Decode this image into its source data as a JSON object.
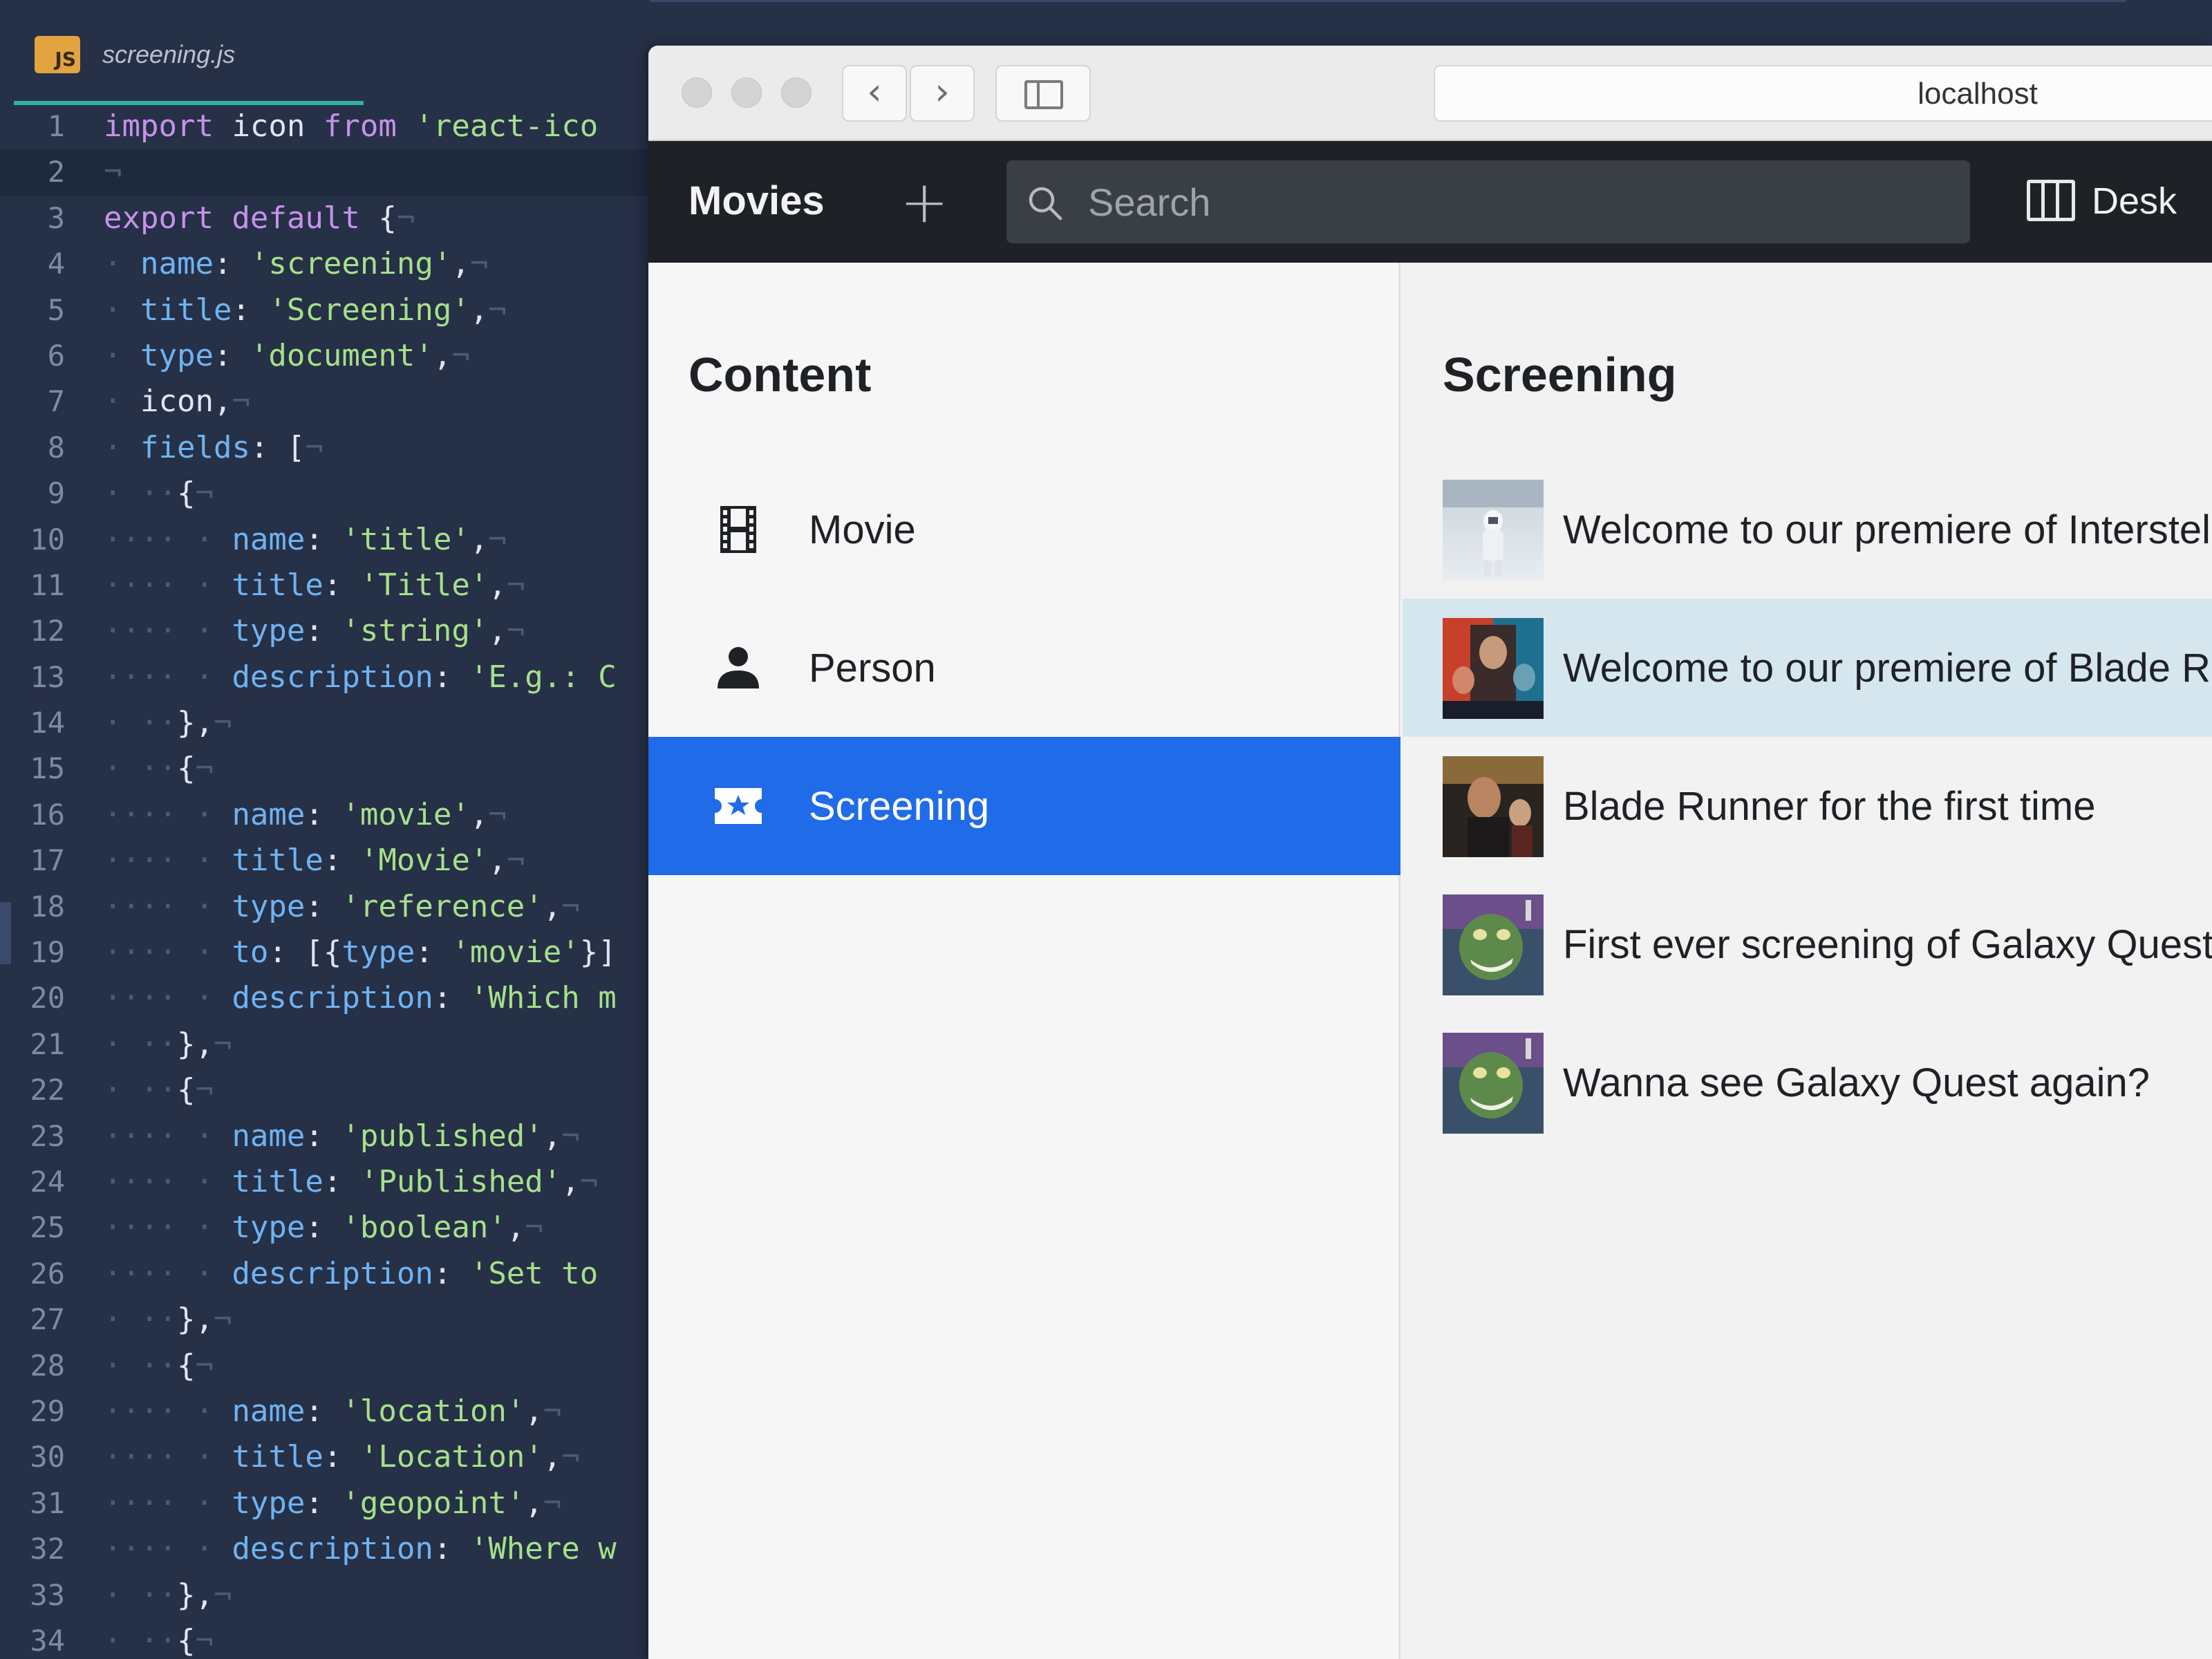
{
  "editor": {
    "file_badge": "JS",
    "file_name": "screening.js",
    "lines": [
      {
        "n": "1",
        "t": [
          [
            "kw",
            "import"
          ],
          [
            "id",
            " icon "
          ],
          [
            "kw",
            "from"
          ],
          [
            "str",
            " 'react-ico"
          ]
        ]
      },
      {
        "n": "2",
        "t": [
          [
            "inv",
            "¬"
          ]
        ]
      },
      {
        "n": "3",
        "t": [
          [
            "kw",
            "export default"
          ],
          [
            "pun",
            " {"
          ],
          [
            "inv",
            "¬"
          ]
        ]
      },
      {
        "n": "4",
        "t": [
          [
            "ws",
            "·"
          ],
          [
            "prop",
            " name"
          ],
          [
            "pun",
            ": "
          ],
          [
            "str",
            "'screening'"
          ],
          [
            "pun",
            ","
          ],
          [
            "inv",
            "¬"
          ]
        ]
      },
      {
        "n": "5",
        "t": [
          [
            "ws",
            "·"
          ],
          [
            "prop",
            " title"
          ],
          [
            "pun",
            ": "
          ],
          [
            "str",
            "'Screening'"
          ],
          [
            "pun",
            ","
          ],
          [
            "inv",
            "¬"
          ]
        ]
      },
      {
        "n": "6",
        "t": [
          [
            "ws",
            "·"
          ],
          [
            "prop",
            " type"
          ],
          [
            "pun",
            ": "
          ],
          [
            "str",
            "'document'"
          ],
          [
            "pun",
            ","
          ],
          [
            "inv",
            "¬"
          ]
        ]
      },
      {
        "n": "7",
        "t": [
          [
            "ws",
            "·"
          ],
          [
            "id",
            " icon,"
          ],
          [
            "inv",
            "¬"
          ]
        ]
      },
      {
        "n": "8",
        "t": [
          [
            "ws",
            "·"
          ],
          [
            "prop",
            " fields"
          ],
          [
            "pun",
            ": ["
          ],
          [
            "inv",
            "¬"
          ]
        ]
      },
      {
        "n": "9",
        "t": [
          [
            "ws",
            "·"
          ],
          [
            "ws",
            " ··"
          ],
          [
            "pun",
            "{"
          ],
          [
            "inv",
            "¬"
          ]
        ]
      },
      {
        "n": "10",
        "t": [
          [
            "ws",
            "···· ·"
          ],
          [
            "prop",
            " name"
          ],
          [
            "pun",
            ": "
          ],
          [
            "str",
            "'title'"
          ],
          [
            "pun",
            ","
          ],
          [
            "inv",
            "¬"
          ]
        ]
      },
      {
        "n": "11",
        "t": [
          [
            "ws",
            "···· ·"
          ],
          [
            "prop",
            " title"
          ],
          [
            "pun",
            ": "
          ],
          [
            "str",
            "'Title'"
          ],
          [
            "pun",
            ","
          ],
          [
            "inv",
            "¬"
          ]
        ]
      },
      {
        "n": "12",
        "t": [
          [
            "ws",
            "···· ·"
          ],
          [
            "prop",
            " type"
          ],
          [
            "pun",
            ": "
          ],
          [
            "str",
            "'string'"
          ],
          [
            "pun",
            ","
          ],
          [
            "inv",
            "¬"
          ]
        ]
      },
      {
        "n": "13",
        "t": [
          [
            "ws",
            "···· ·"
          ],
          [
            "prop",
            " description"
          ],
          [
            "pun",
            ": "
          ],
          [
            "str",
            "'E.g.: C"
          ]
        ]
      },
      {
        "n": "14",
        "t": [
          [
            "ws",
            "·"
          ],
          [
            "ws",
            " ··"
          ],
          [
            "pun",
            "},"
          ],
          [
            "inv",
            "¬"
          ]
        ]
      },
      {
        "n": "15",
        "t": [
          [
            "ws",
            "·"
          ],
          [
            "ws",
            " ··"
          ],
          [
            "pun",
            "{"
          ],
          [
            "inv",
            "¬"
          ]
        ]
      },
      {
        "n": "16",
        "t": [
          [
            "ws",
            "···· ·"
          ],
          [
            "prop",
            " name"
          ],
          [
            "pun",
            ": "
          ],
          [
            "str",
            "'movie'"
          ],
          [
            "pun",
            ","
          ],
          [
            "inv",
            "¬"
          ]
        ]
      },
      {
        "n": "17",
        "t": [
          [
            "ws",
            "···· ·"
          ],
          [
            "prop",
            " title"
          ],
          [
            "pun",
            ": "
          ],
          [
            "str",
            "'Movie'"
          ],
          [
            "pun",
            ","
          ],
          [
            "inv",
            "¬"
          ]
        ]
      },
      {
        "n": "18",
        "t": [
          [
            "ws",
            "···· ·"
          ],
          [
            "prop",
            " type"
          ],
          [
            "pun",
            ": "
          ],
          [
            "str",
            "'reference'"
          ],
          [
            "pun",
            ","
          ],
          [
            "inv",
            "¬"
          ]
        ]
      },
      {
        "n": "19",
        "t": [
          [
            "ws",
            "···· ·"
          ],
          [
            "prop",
            " to"
          ],
          [
            "pun",
            ": [{"
          ],
          [
            "prop",
            "type"
          ],
          [
            "pun",
            ": "
          ],
          [
            "str",
            "'movie'"
          ],
          [
            "pun",
            "}]"
          ]
        ]
      },
      {
        "n": "20",
        "t": [
          [
            "ws",
            "···· ·"
          ],
          [
            "prop",
            " description"
          ],
          [
            "pun",
            ": "
          ],
          [
            "str",
            "'Which m"
          ]
        ]
      },
      {
        "n": "21",
        "t": [
          [
            "ws",
            "·"
          ],
          [
            "ws",
            " ··"
          ],
          [
            "pun",
            "},"
          ],
          [
            "inv",
            "¬"
          ]
        ]
      },
      {
        "n": "22",
        "t": [
          [
            "ws",
            "·"
          ],
          [
            "ws",
            " ··"
          ],
          [
            "pun",
            "{"
          ],
          [
            "inv",
            "¬"
          ]
        ]
      },
      {
        "n": "23",
        "t": [
          [
            "ws",
            "···· ·"
          ],
          [
            "prop",
            " name"
          ],
          [
            "pun",
            ": "
          ],
          [
            "str",
            "'published'"
          ],
          [
            "pun",
            ","
          ],
          [
            "inv",
            "¬"
          ]
        ]
      },
      {
        "n": "24",
        "t": [
          [
            "ws",
            "···· ·"
          ],
          [
            "prop",
            " title"
          ],
          [
            "pun",
            ": "
          ],
          [
            "str",
            "'Published'"
          ],
          [
            "pun",
            ","
          ],
          [
            "inv",
            "¬"
          ]
        ]
      },
      {
        "n": "25",
        "t": [
          [
            "ws",
            "···· ·"
          ],
          [
            "prop",
            " type"
          ],
          [
            "pun",
            ": "
          ],
          [
            "str",
            "'boolean'"
          ],
          [
            "pun",
            ","
          ],
          [
            "inv",
            "¬"
          ]
        ]
      },
      {
        "n": "26",
        "t": [
          [
            "ws",
            "···· ·"
          ],
          [
            "prop",
            " description"
          ],
          [
            "pun",
            ": "
          ],
          [
            "str",
            "'Set to"
          ]
        ]
      },
      {
        "n": "27",
        "t": [
          [
            "ws",
            "·"
          ],
          [
            "ws",
            " ··"
          ],
          [
            "pun",
            "},"
          ],
          [
            "inv",
            "¬"
          ]
        ]
      },
      {
        "n": "28",
        "t": [
          [
            "ws",
            "·"
          ],
          [
            "ws",
            " ··"
          ],
          [
            "pun",
            "{"
          ],
          [
            "inv",
            "¬"
          ]
        ]
      },
      {
        "n": "29",
        "t": [
          [
            "ws",
            "···· ·"
          ],
          [
            "prop",
            " name"
          ],
          [
            "pun",
            ": "
          ],
          [
            "str",
            "'location'"
          ],
          [
            "pun",
            ","
          ],
          [
            "inv",
            "¬"
          ]
        ]
      },
      {
        "n": "30",
        "t": [
          [
            "ws",
            "···· ·"
          ],
          [
            "prop",
            " title"
          ],
          [
            "pun",
            ": "
          ],
          [
            "str",
            "'Location'"
          ],
          [
            "pun",
            ","
          ],
          [
            "inv",
            "¬"
          ]
        ]
      },
      {
        "n": "31",
        "t": [
          [
            "ws",
            "···· ·"
          ],
          [
            "prop",
            " type"
          ],
          [
            "pun",
            ": "
          ],
          [
            "str",
            "'geopoint'"
          ],
          [
            "pun",
            ","
          ],
          [
            "inv",
            "¬"
          ]
        ]
      },
      {
        "n": "32",
        "t": [
          [
            "ws",
            "···· ·"
          ],
          [
            "prop",
            " description"
          ],
          [
            "pun",
            ": "
          ],
          [
            "str",
            "'Where w"
          ]
        ]
      },
      {
        "n": "33",
        "t": [
          [
            "ws",
            "·"
          ],
          [
            "ws",
            " ··"
          ],
          [
            "pun",
            "},"
          ],
          [
            "inv",
            "¬"
          ]
        ]
      },
      {
        "n": "34",
        "t": [
          [
            "ws",
            "·"
          ],
          [
            "ws",
            " ··"
          ],
          [
            "pun",
            "{"
          ],
          [
            "inv",
            "¬"
          ]
        ]
      }
    ]
  },
  "browser": {
    "back_icon": "chevron-left-icon",
    "forward_icon": "chevron-right-icon",
    "url": "localhost"
  },
  "app": {
    "brand": "Movies",
    "search_placeholder": "Search",
    "desk_label": "Desk"
  },
  "content_pane": {
    "title": "Content",
    "items": [
      {
        "label": "Movie",
        "icon": "film-icon"
      },
      {
        "label": "Person",
        "icon": "person-icon"
      },
      {
        "label": "Screening",
        "icon": "ticket-star-icon"
      }
    ]
  },
  "screening_pane": {
    "title": "Screening",
    "items": [
      {
        "label": "Welcome to our premiere of Interstellar"
      },
      {
        "label": "Welcome to our premiere of Blade Runner"
      },
      {
        "label": "Blade Runner for the first time"
      },
      {
        "label": "First ever screening of Galaxy Quest"
      },
      {
        "label": "Wanna see Galaxy Quest again?"
      }
    ]
  },
  "colors": {
    "editor_bg": "#263047",
    "accent_selected": "#1f6be8",
    "active_row": "#d6e6ef",
    "appbar": "#1e2126"
  }
}
